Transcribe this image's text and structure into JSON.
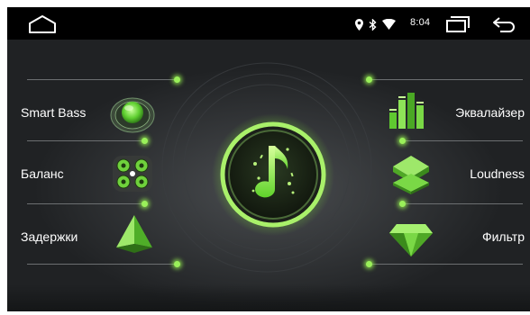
{
  "status_bar": {
    "time": "8:04",
    "icons": [
      "home-icon",
      "location-pin-icon",
      "bluetooth-icon",
      "wifi-icon",
      "recents-icon",
      "back-arrow-icon"
    ]
  },
  "menu": {
    "left": [
      {
        "label": "Smart Bass",
        "icon": "smart-bass-icon"
      },
      {
        "label": "Баланс",
        "icon": "balance-speakers-icon"
      },
      {
        "label": "Задержки",
        "icon": "delay-pyramid-icon"
      }
    ],
    "right": [
      {
        "label": "Эквалайзер",
        "icon": "equalizer-bars-icon"
      },
      {
        "label": "Loudness",
        "icon": "loudness-layers-icon"
      },
      {
        "label": "Фильтр",
        "icon": "filter-gem-icon"
      }
    ]
  },
  "center": {
    "icon": "music-note-icon"
  },
  "colors": {
    "accent": "#7ee03a",
    "background": "#202224",
    "status_bar": "#000000"
  }
}
